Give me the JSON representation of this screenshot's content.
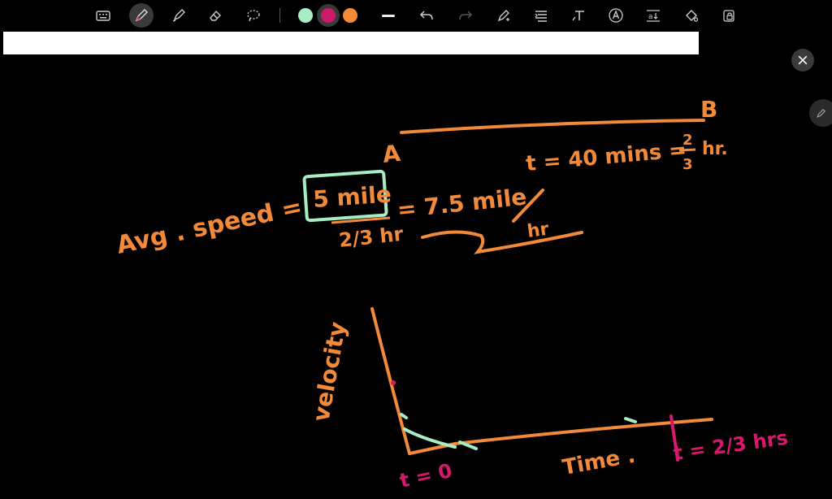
{
  "toolbar": {
    "tools": [
      {
        "name": "keyboard-icon"
      },
      {
        "name": "pen-icon",
        "active": true
      },
      {
        "name": "highlighter-icon"
      },
      {
        "name": "eraser-icon"
      },
      {
        "name": "lasso-icon"
      }
    ],
    "colors": [
      "#a8ecc4",
      "#cc1a6b",
      "#f28a3a"
    ],
    "selected_color": "#cc1a6b",
    "actions": [
      {
        "name": "stroke-width-icon"
      },
      {
        "name": "undo-icon"
      },
      {
        "name": "redo-icon"
      },
      {
        "name": "shape-pen-icon"
      },
      {
        "name": "text-align-icon"
      },
      {
        "name": "text-tool-icon"
      },
      {
        "name": "text-style-icon"
      },
      {
        "name": "text-size-icon"
      },
      {
        "name": "fill-icon"
      },
      {
        "name": "lock-icon"
      }
    ]
  },
  "canvas": {
    "ink_colors": {
      "orange": "#f28a3a",
      "mint": "#a8ecc4",
      "magenta": "#d6196d"
    },
    "point_a": "A",
    "point_b": "B",
    "time_eq": "t = 40 mins = ",
    "frac_num": "2",
    "frac_den": "3",
    "hr": "hr.",
    "avg_speed": "Avg . speed =",
    "dist": "5 mile",
    "denom": "2/3 hr",
    "result": "= 7.5 mile",
    "per_hr": "hr",
    "axis_y": "velocity",
    "axis_x": "Time .",
    "t_zero": "t = 0",
    "t_end": "t = 2/3 hrs"
  }
}
